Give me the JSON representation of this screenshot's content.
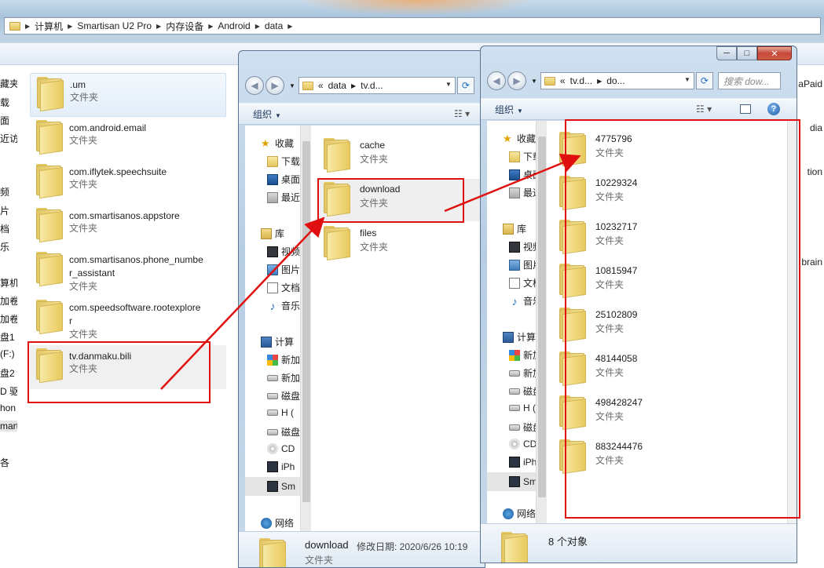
{
  "bg_window": {
    "breadcrumbs": [
      "计算机",
      "Smartisan U2 Pro",
      "内存设备",
      "Android",
      "data"
    ],
    "nav_fragments": [
      "藏夹",
      "载",
      "面",
      "近访",
      "频",
      "片",
      "档",
      "乐",
      "算机",
      "加卷",
      "加卷",
      "盘1",
      "(F:)",
      "盘2",
      "D 驱",
      "hon",
      "mart",
      "各"
    ],
    "folders": [
      {
        "name": ".um",
        "type": "文件夹"
      },
      {
        "name": "com.android.email",
        "type": "文件夹"
      },
      {
        "name": "com.iflytek.speechsuite",
        "type": "文件夹"
      },
      {
        "name": "com.smartisanos.appstore",
        "type": "文件夹"
      },
      {
        "name": "com.smartisanos.phone_numbe",
        "name2": "r_assistant",
        "type": "文件夹"
      },
      {
        "name": "com.speedsoftware.rootexplore",
        "name2": "r",
        "type": "文件夹"
      },
      {
        "name": "tv.danmaku.bili",
        "type": "文件夹"
      }
    ],
    "right_edge_fragments": [
      "aPaid",
      "dia",
      "tion",
      "brain"
    ]
  },
  "win2": {
    "address": {
      "prefix": "«",
      "part1": "data",
      "part2": "tv.d..."
    },
    "organize_label": "组织",
    "nav": {
      "favorites": "收藏",
      "downloads": "下载",
      "desktop": "桌面",
      "recent": "最近",
      "libraries": "库",
      "video": "视频",
      "pictures": "图片",
      "documents": "文档",
      "music": "音乐",
      "computer": "计算",
      "new1": "新加",
      "new2": "新加",
      "disk1": "磁盘",
      "h": "H (",
      "disk2": "磁盘",
      "cd": "CD",
      "iphone": "iPh",
      "smart": "Sm",
      "network": "网络"
    },
    "folders": [
      {
        "name": "cache",
        "type": "文件夹"
      },
      {
        "name": "download",
        "type": "文件夹"
      },
      {
        "name": "files",
        "type": "文件夹"
      }
    ],
    "details": {
      "name": "download",
      "meta": "修改日期: 2020/6/26 10:19",
      "type": "文件夹"
    }
  },
  "win3": {
    "caption": {
      "minimize": "─",
      "maximize": "□",
      "close": "✕"
    },
    "address": {
      "prefix": "«",
      "part1": "tv.d...",
      "part2": "do..."
    },
    "search_placeholder": "搜索 dow...",
    "organize_label": "组织",
    "nav": {
      "favorites": "收藏",
      "downloads": "下载",
      "desktop": "桌面",
      "recent": "最近",
      "libraries": "库",
      "video": "视频",
      "pictures": "图片",
      "documents": "文档",
      "music": "音乐",
      "computer": "计算",
      "new1": "新加",
      "new2": "新加",
      "disk1": "磁盘",
      "h": "H (",
      "disk2": "磁盘",
      "cd": "CD",
      "iphone": "iPh",
      "smart": "Sm",
      "network": "网络"
    },
    "folders": [
      {
        "name": "4775796",
        "type": "文件夹"
      },
      {
        "name": "10229324",
        "type": "文件夹"
      },
      {
        "name": "10232717",
        "type": "文件夹"
      },
      {
        "name": "10815947",
        "type": "文件夹"
      },
      {
        "name": "25102809",
        "type": "文件夹"
      },
      {
        "name": "48144058",
        "type": "文件夹"
      },
      {
        "name": "498428247",
        "type": "文件夹"
      },
      {
        "name": "883244476",
        "type": "文件夹"
      }
    ],
    "status": "8 个对象"
  },
  "annotation_color": "#e01010"
}
